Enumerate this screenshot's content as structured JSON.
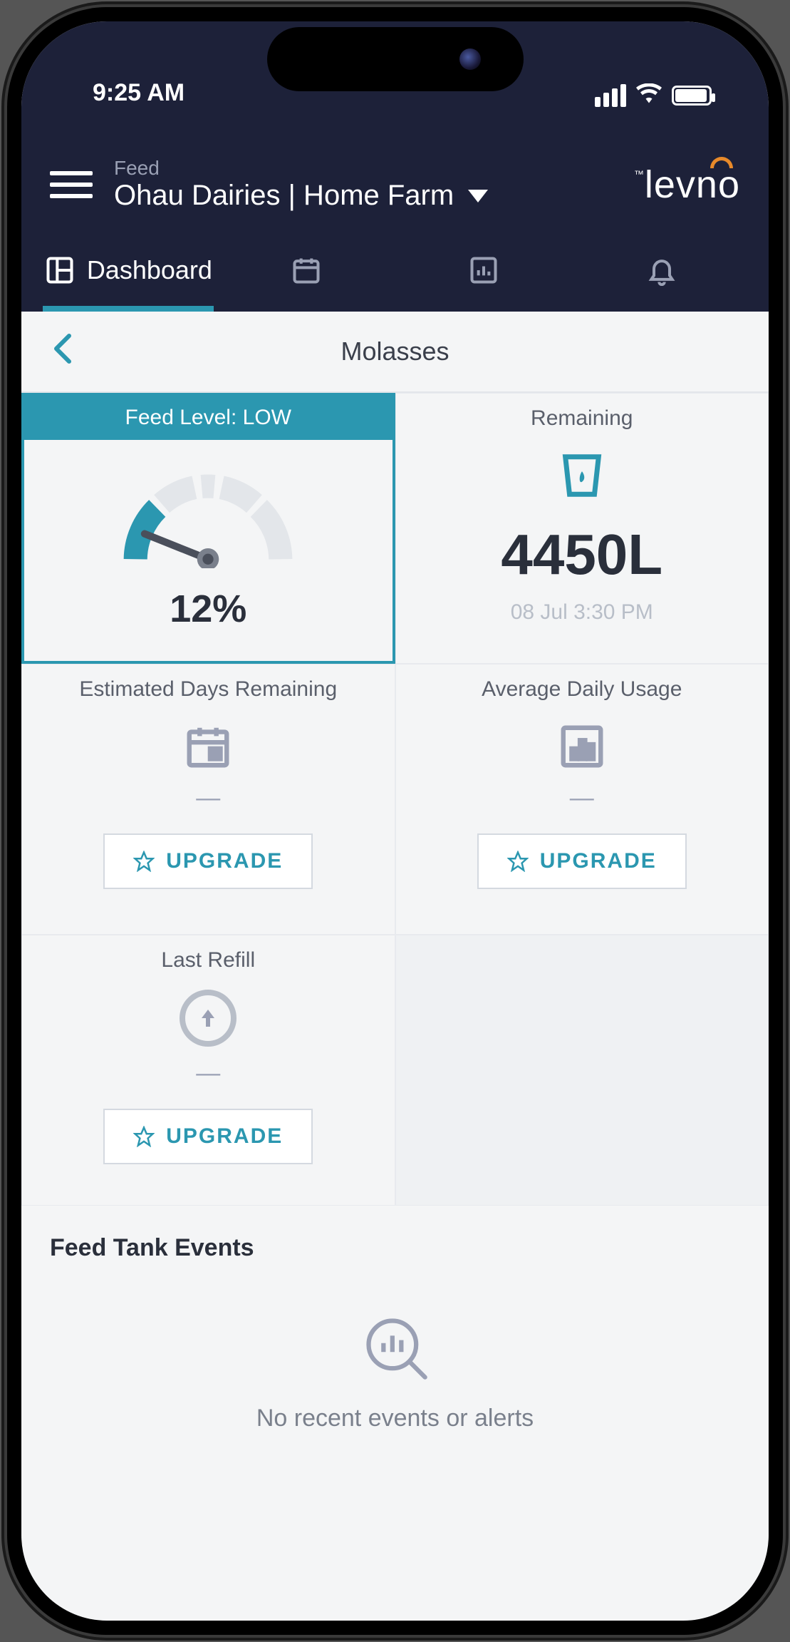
{
  "status": {
    "time": "9:25 AM"
  },
  "header": {
    "section_label": "Feed",
    "location": "Ohau Dairies | Home Farm",
    "brand": "levno"
  },
  "tabs": {
    "dashboard": "Dashboard"
  },
  "subheader": {
    "title": "Molasses"
  },
  "tiles": {
    "feed_level": {
      "banner": "Feed Level: LOW",
      "percent": "12%"
    },
    "remaining": {
      "title": "Remaining",
      "value": "4450L",
      "timestamp": "08 Jul 3:30 PM"
    },
    "days_remaining": {
      "title": "Estimated Days Remaining",
      "value": "—",
      "upgrade": "UPGRADE"
    },
    "avg_usage": {
      "title": "Average Daily Usage",
      "value": "—",
      "upgrade": "UPGRADE"
    },
    "last_refill": {
      "title": "Last Refill",
      "value": "—",
      "upgrade": "UPGRADE"
    }
  },
  "events": {
    "title": "Feed Tank Events",
    "empty_text": "No recent events or alerts"
  },
  "chart_data": {
    "type": "bar",
    "title": "Feed Level",
    "categories": [
      "Feed Level"
    ],
    "values": [
      12
    ],
    "ylabel": "Percent",
    "ylim": [
      0,
      100
    ],
    "annotations": [
      "LOW"
    ]
  }
}
